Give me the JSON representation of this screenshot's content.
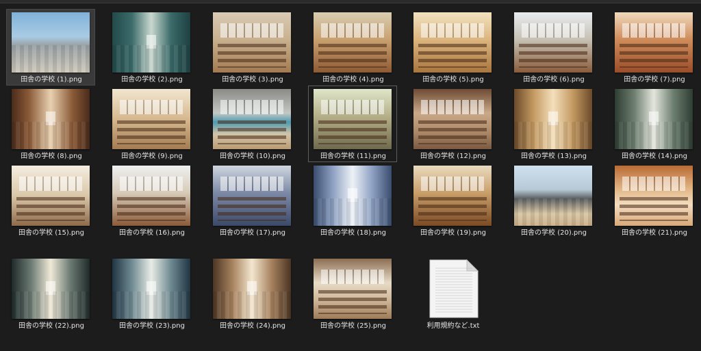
{
  "files": [
    {
      "name": "田舎の学校 (1).png",
      "scene": "sc-exterior"
    },
    {
      "name": "田舎の学校 (2).png",
      "scene": "sc-hall-teal"
    },
    {
      "name": "田舎の学校 (3).png",
      "scene": "sc-room-chairs"
    },
    {
      "name": "田舎の学校 (4).png",
      "scene": "sc-room-desks"
    },
    {
      "name": "田舎の学校 (5).png",
      "scene": "sc-room-bright"
    },
    {
      "name": "田舎の学校 (6).png",
      "scene": "sc-room-white"
    },
    {
      "name": "田舎の学校 (7).png",
      "scene": "sc-room-red"
    },
    {
      "name": "田舎の学校 (8).png",
      "scene": "sc-hall-wood"
    },
    {
      "name": "田舎の学校 (9).png",
      "scene": "sc-room-warm"
    },
    {
      "name": "田舎の学校 (10).png",
      "scene": "sc-gym-teal"
    },
    {
      "name": "田舎の学校 (11).png",
      "scene": "sc-room-green"
    },
    {
      "name": "田舎の学校 (12).png",
      "scene": "sc-gym-brown"
    },
    {
      "name": "田舎の学校 (13).png",
      "scene": "sc-hall-amber"
    },
    {
      "name": "田舎の学校 (14).png",
      "scene": "sc-hall-green"
    },
    {
      "name": "田舎の学校 (15).png",
      "scene": "sc-room-piano"
    },
    {
      "name": "田舎の学校 (16).png",
      "scene": "sc-room-light"
    },
    {
      "name": "田舎の学校 (17).png",
      "scene": "sc-room-blue"
    },
    {
      "name": "田舎の学校 (18).png",
      "scene": "sc-hall-blue"
    },
    {
      "name": "田舎の学校 (19).png",
      "scene": "sc-room-board"
    },
    {
      "name": "田舎の学校 (20).png",
      "scene": "sc-building"
    },
    {
      "name": "田舎の学校 (21).png",
      "scene": "sc-gym-orange"
    },
    {
      "name": "田舎の学校 (22).png",
      "scene": "sc-hall-dark"
    },
    {
      "name": "田舎の学校 (23).png",
      "scene": "sc-hall-steel"
    },
    {
      "name": "田舎の学校 (24).png",
      "scene": "sc-hall-sand"
    },
    {
      "name": "田舎の学校 (25).png",
      "scene": "sc-gym-pale"
    },
    {
      "name": "利用規約など.txt",
      "scene": "txt"
    }
  ],
  "selected_index": 0,
  "focused_index": 10,
  "colors": {
    "background": "#1c1c1c",
    "label": "#e6e6e6",
    "selection": "#3a3a3a"
  }
}
